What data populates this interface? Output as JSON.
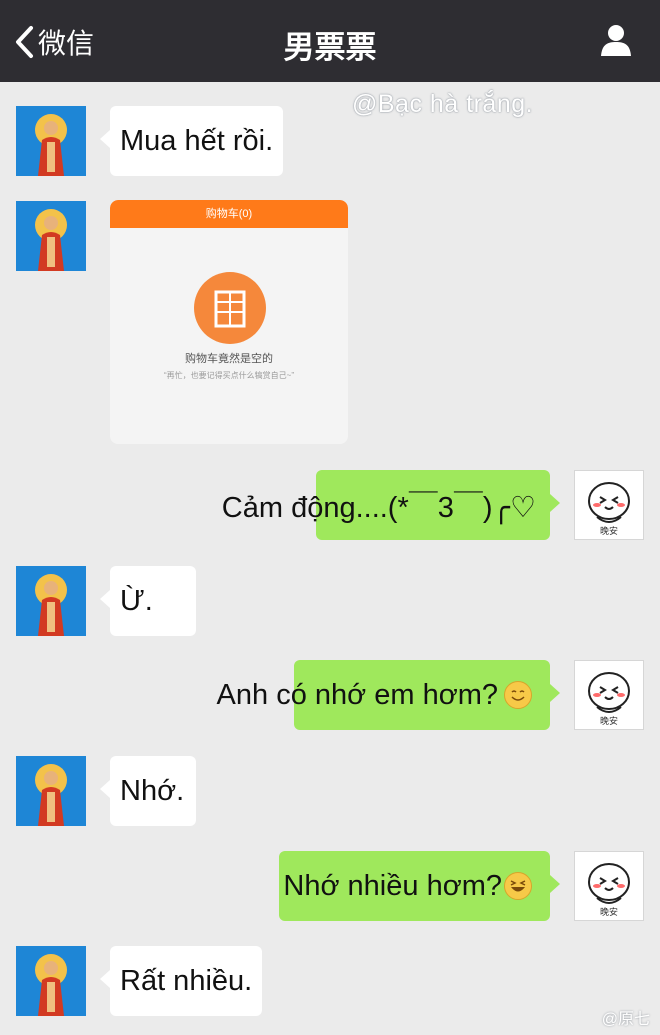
{
  "header": {
    "back_label": "微信",
    "title": "男票票"
  },
  "watermark": "@Bạc hà trắng.",
  "shared_image": {
    "header_text": "购物车(0)",
    "main_text": "购物车竟然是空的",
    "sub_text": "“再忙，也要记得买点什么犒赏自己~”"
  },
  "messages": [
    {
      "side": "left",
      "text": "Mua hết rồi."
    },
    {
      "side": "left",
      "type": "image"
    },
    {
      "side": "right",
      "text": "Cảm động....(*￣3￣)╭♡"
    },
    {
      "side": "left",
      "text": "Ừ."
    },
    {
      "side": "right",
      "text": "Anh có nhớ em hơm?",
      "emoji": "smile-emoji"
    },
    {
      "side": "left",
      "text": "Nhớ."
    },
    {
      "side": "right",
      "text": "Nhớ nhiều hơm?",
      "emoji": "laugh-emoji"
    },
    {
      "side": "left",
      "text": "Rất nhiều."
    }
  ],
  "sticker_caption": "晚安",
  "footer_watermark": "@原七",
  "colors": {
    "topbar": "#2e2d32",
    "chat_background": "#ebebeb",
    "sent_bubble": "#9fe85c",
    "received_bubble": "#ffffff"
  }
}
